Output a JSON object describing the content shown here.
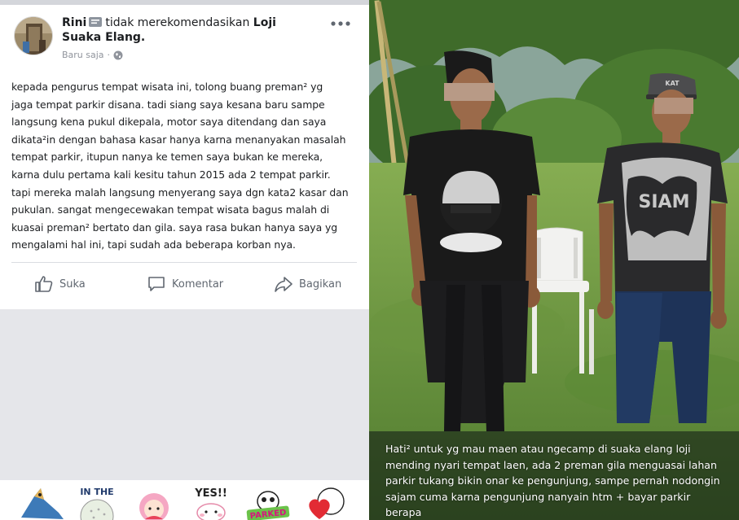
{
  "post": {
    "author": "Rini",
    "action_text": "tidak merekomendasikan",
    "place": "Loji Suaka Elang.",
    "time": "Baru saja",
    "body": "kepada pengurus tempat wisata ini, tolong buang preman² yg\njaga tempat parkir disana. tadi siang saya kesana baru sampe\nlangsung kena pukul dikepala, motor saya ditendang dan saya\ndikata²in dengan bahasa kasar hanya karna menanyakan masalah\ntempat parkir, itupun nanya ke temen saya bukan ke mereka,\nkarna dulu pertama kali kesitu tahun 2015 ada 2 tempat parkir.\ntapi mereka malah langsung menyerang saya dgn kata2 kasar dan\npukulan. sangat mengecewakan tempat wisata bagus malah di\nkuasai preman² bertato dan gila. saya rasa bukan hanya saya yg\nmengalami hal ini, tapi sudah ada beberapa korban nya.",
    "actions": {
      "like": "Suka",
      "comment": "Komentar",
      "share": "Bagikan"
    }
  },
  "stickers": [
    {
      "icon": "bird-sticker"
    },
    {
      "icon": "in-the-golf-sticker",
      "text": "IN THE"
    },
    {
      "icon": "pink-girl-sticker"
    },
    {
      "icon": "yes-bunny-sticker",
      "text": "YES!!"
    },
    {
      "icon": "parked-sticker",
      "text": "PARKED"
    },
    {
      "icon": "heart-sticker"
    }
  ],
  "photo": {
    "shirt_text_right": "SIAM",
    "cap_text": "KAT",
    "caption": "Hati² untuk yg mau maen atau ngecamp di suaka elang loji\nmending nyari tempat laen, ada 2 preman gila menguasai lahan\nparkir tukang bikin onar ke pengunjung, sampe pernah nodongin\nsajam cuma karna pengunjung nanyain htm + bayar parkir\nberapa"
  },
  "colors": {
    "fb_text": "#1c1e21",
    "fb_meta": "#90949c",
    "fb_action": "#606770",
    "grass": "#6f9a45"
  }
}
